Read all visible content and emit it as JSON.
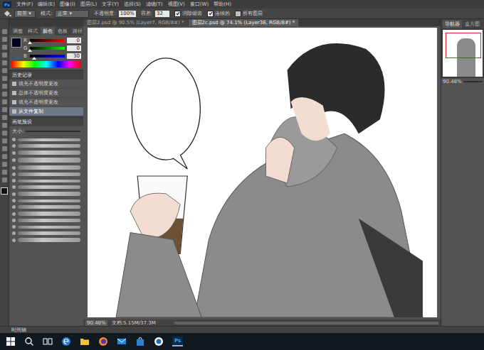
{
  "app": {
    "logo": "Ps"
  },
  "menu": [
    "文件(F)",
    "编辑(E)",
    "图像(I)",
    "图层(L)",
    "文字(Y)",
    "选择(S)",
    "滤镜(T)",
    "视图(V)",
    "窗口(W)",
    "帮助(H)"
  ],
  "options": {
    "source": "前景",
    "mode_label": "模式:",
    "mode": "正常",
    "opacity_label": "不透明度:",
    "opacity": "100%",
    "tolerance_label": "容差:",
    "tolerance": "32",
    "checks": [
      {
        "label": "消除锯齿",
        "checked": true
      },
      {
        "label": "连续的",
        "checked": true
      },
      {
        "label": "所有图层",
        "checked": false
      }
    ]
  },
  "doc_tabs": [
    {
      "label": "图层2.psd @ 90.5% (Layer7, RGB/8#) *",
      "selected": false
    },
    {
      "label": "图层2c.psd @ 74.1% (Layer36, RGB/8#) *",
      "selected": true
    }
  ],
  "color_panel": {
    "tabs": [
      {
        "label": "调整",
        "selected": false
      },
      {
        "label": "样式",
        "selected": false
      },
      {
        "label": "颜色",
        "selected": true
      },
      {
        "label": "色板",
        "selected": false
      },
      {
        "label": "路径",
        "selected": false
      }
    ],
    "sliders": [
      {
        "name": "R",
        "value": "0",
        "level": 0,
        "color": "#ff0000"
      },
      {
        "name": "G",
        "value": "0",
        "level": 0,
        "color": "#00ff00"
      },
      {
        "name": "B",
        "value": "30",
        "level": 0.12,
        "color": "#0000ff"
      }
    ]
  },
  "history": {
    "title": "历史记录",
    "items": [
      {
        "label": "填充不透明度更改",
        "selected": false
      },
      {
        "label": "总体不透明度更改",
        "selected": false
      },
      {
        "label": "填充不透明度更改",
        "selected": false
      },
      {
        "label": "从文件复制",
        "selected": true
      }
    ]
  },
  "brushes": {
    "title": "画笔预设",
    "size_label": "大小:"
  },
  "navigator": {
    "tabs": [
      {
        "label": "导航器",
        "selected": true
      },
      {
        "label": "直方图",
        "selected": false
      }
    ],
    "zoom": "90.48%"
  },
  "status_bar": {
    "zoom": "90.48%",
    "doc": "文档:5.15M/37.3M"
  },
  "timeline": {
    "title": "时间轴"
  },
  "taskbar": {
    "ps_label": "Ps"
  }
}
